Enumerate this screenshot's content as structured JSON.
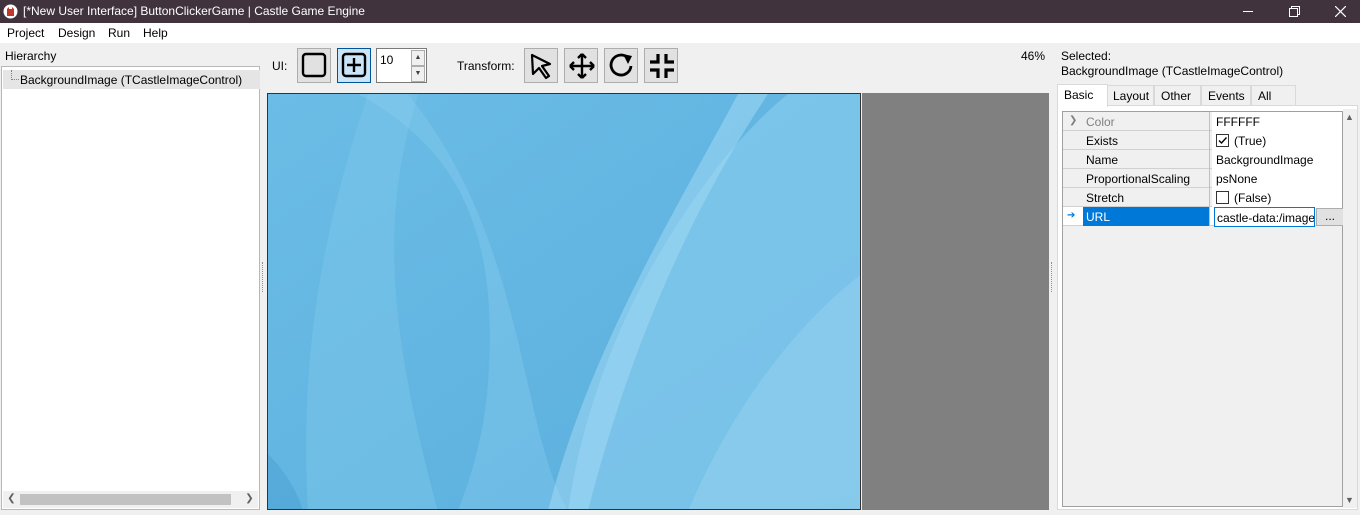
{
  "window": {
    "title": "[*New User Interface] ButtonClickerGame | Castle Game Engine"
  },
  "menu": [
    "Project",
    "Design",
    "Run",
    "Help"
  ],
  "hierarchy": {
    "label": "Hierarchy",
    "items": [
      {
        "label": "BackgroundImage (TCastleImageControl)"
      }
    ]
  },
  "toolbar": {
    "ui_label": "UI:",
    "spin_value": "10",
    "transform_label": "Transform:",
    "zoom": "46%"
  },
  "inspector": {
    "selected_label": "Selected:",
    "selected_value": "BackgroundImage (TCastleImageControl)",
    "tabs": [
      "Basic",
      "Layout",
      "Other",
      "Events",
      "All"
    ],
    "active_tab": "Basic",
    "properties": [
      {
        "name": "Color",
        "value": "FFFFFF"
      },
      {
        "name": "Exists",
        "value": "(True)",
        "checked": true
      },
      {
        "name": "Name",
        "value": "BackgroundImage"
      },
      {
        "name": "ProportionalScaling",
        "value": "psNone"
      },
      {
        "name": "Stretch",
        "value": "(False)",
        "checked": false
      },
      {
        "name": "URL",
        "value": "castle-data:/image",
        "button": "..."
      }
    ]
  },
  "colors": {
    "titlebar": "#40333e",
    "selection": "#0078d7",
    "canvas_blue": "#63b4e0",
    "canvas_bg": "#808080"
  }
}
